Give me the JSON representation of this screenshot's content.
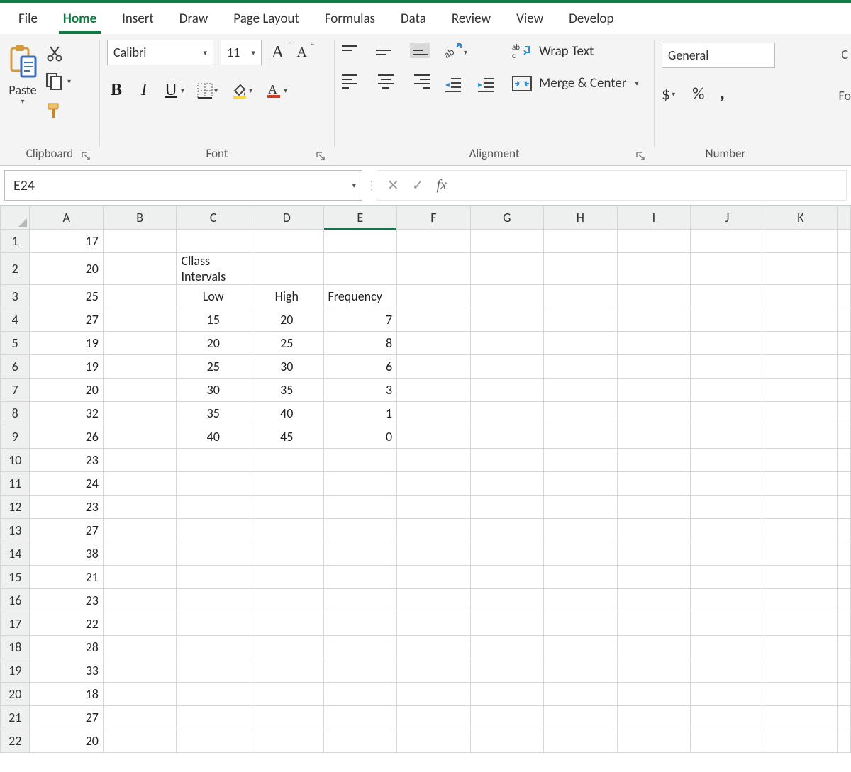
{
  "tabs": {
    "file": "File",
    "home": "Home",
    "insert": "Insert",
    "draw": "Draw",
    "pagelayout": "Page Layout",
    "formulas": "Formulas",
    "data": "Data",
    "review": "Review",
    "view": "View",
    "developer": "Develop"
  },
  "ribbon": {
    "clipboard": {
      "paste": "Paste",
      "label": "Clipboard"
    },
    "font": {
      "label": "Font",
      "name": "Calibri",
      "size": "11",
      "bold": "B",
      "italic": "I",
      "underline": "U",
      "growA": "A",
      "shrinkA": "A"
    },
    "alignment": {
      "label": "Alignment",
      "wrap": "Wrap Text",
      "merge": "Merge & Center"
    },
    "number": {
      "label": "Number",
      "format": "General",
      "dollar": "$",
      "percent": "%",
      "comma": ","
    },
    "edgeC": "C",
    "edgeFo": "Fo"
  },
  "fx": {
    "namebox": "E24",
    "fx_label": "fx",
    "x": "✕",
    "check": "✓"
  },
  "grid": {
    "cols": [
      "A",
      "B",
      "C",
      "D",
      "E",
      "F",
      "G",
      "H",
      "I",
      "J",
      "K"
    ],
    "rows": [
      "1",
      "2",
      "3",
      "4",
      "5",
      "6",
      "7",
      "8",
      "9",
      "10",
      "11",
      "12",
      "13",
      "14",
      "15",
      "16",
      "17",
      "18",
      "19",
      "20",
      "21",
      "22"
    ],
    "colA": [
      "17",
      "20",
      "25",
      "27",
      "19",
      "19",
      "20",
      "32",
      "26",
      "23",
      "24",
      "23",
      "27",
      "38",
      "21",
      "23",
      "22",
      "28",
      "33",
      "18",
      "27",
      "20"
    ],
    "c2": "Cllass Intervals",
    "c3": "Low",
    "d3": "High",
    "e3": "Frequency",
    "table": [
      {
        "low": "15",
        "high": "20",
        "freq": "7"
      },
      {
        "low": "20",
        "high": "25",
        "freq": "8"
      },
      {
        "low": "25",
        "high": "30",
        "freq": "6"
      },
      {
        "low": "30",
        "high": "35",
        "freq": "3"
      },
      {
        "low": "35",
        "high": "40",
        "freq": "1"
      },
      {
        "low": "40",
        "high": "45",
        "freq": "0"
      }
    ]
  },
  "chart_data": {
    "type": "table",
    "title": "Cllass Intervals",
    "columns": [
      "Low",
      "High",
      "Frequency"
    ],
    "rows": [
      [
        15,
        20,
        7
      ],
      [
        20,
        25,
        8
      ],
      [
        25,
        30,
        6
      ],
      [
        30,
        35,
        3
      ],
      [
        35,
        40,
        1
      ],
      [
        40,
        45,
        0
      ]
    ],
    "raw_values_column_A": [
      17,
      20,
      25,
      27,
      19,
      19,
      20,
      32,
      26,
      23,
      24,
      23,
      27,
      38,
      21,
      23,
      22,
      28,
      33,
      18,
      27,
      20
    ]
  }
}
